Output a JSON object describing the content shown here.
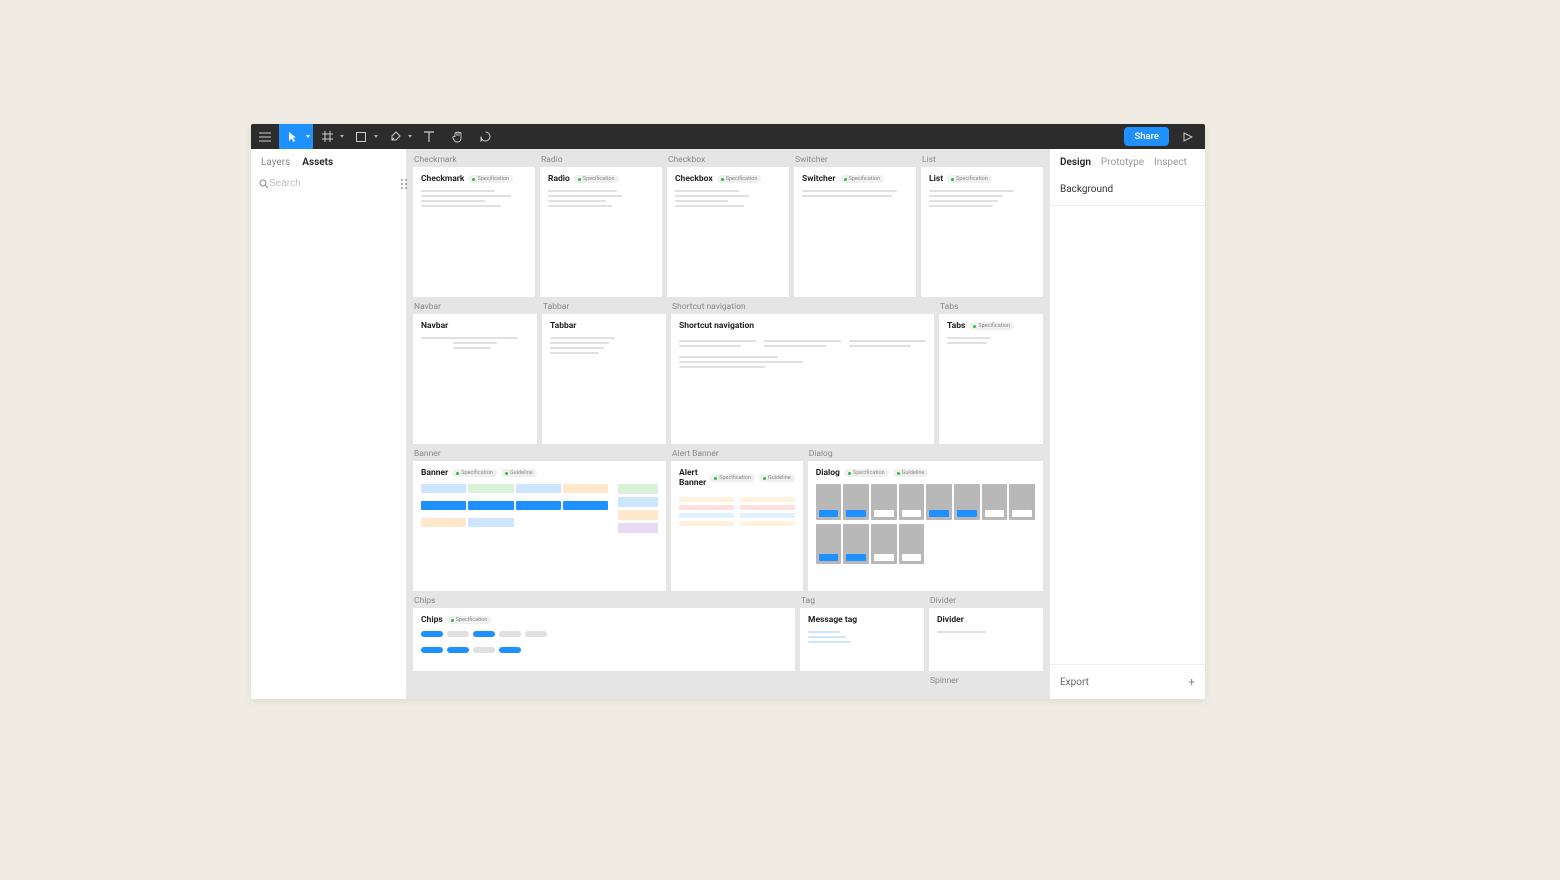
{
  "toolbar": {
    "share_label": "Share"
  },
  "left_panel": {
    "tabs": {
      "layers": "Layers",
      "assets": "Assets"
    },
    "search_placeholder": "Search"
  },
  "right_panel": {
    "tabs": {
      "design": "Design",
      "prototype": "Prototype",
      "inspect": "Inspect"
    },
    "background_label": "Background",
    "export_label": "Export"
  },
  "pills": {
    "specification": "Specification",
    "guideline": "Guideline"
  },
  "frames": {
    "row1": [
      {
        "label": "Checkmark",
        "title": "Checkmark",
        "pills": [
          "specification"
        ]
      },
      {
        "label": "Radio",
        "title": "Radio",
        "pills": [
          "specification"
        ]
      },
      {
        "label": "Checkbox",
        "title": "Checkbox",
        "pills": [
          "specification"
        ]
      },
      {
        "label": "Switcher",
        "title": "Switcher",
        "pills": [
          "specification"
        ]
      },
      {
        "label": "List",
        "title": "List",
        "pills": [
          "specification"
        ]
      }
    ],
    "row2": [
      {
        "label": "Navbar",
        "title": "Navbar",
        "pills": []
      },
      {
        "label": "Tabbar",
        "title": "Tabbar",
        "pills": []
      },
      {
        "label": "Shortcut navigation",
        "title": "Shortcut navigation",
        "pills": []
      },
      {
        "label": "Tabs",
        "title": "Tabs",
        "pills": [
          "specification"
        ]
      }
    ],
    "row3": [
      {
        "label": "Banner",
        "title": "Banner",
        "pills": [
          "specification",
          "guideline"
        ]
      },
      {
        "label": "Alert Banner",
        "title": "Alert Banner",
        "pills": [
          "specification",
          "guideline"
        ]
      },
      {
        "label": "Dialog",
        "title": "Dialog",
        "pills": [
          "specification",
          "guideline"
        ]
      }
    ],
    "row4": [
      {
        "label": "Chips",
        "title": "Chips",
        "pills": [
          "specification"
        ]
      },
      {
        "label": "Tag",
        "title": "Message tag",
        "pills": []
      },
      {
        "label": "Divider",
        "title": "Divider",
        "pills": []
      }
    ],
    "row5": [
      {
        "label": "Spinner",
        "title": "",
        "pills": []
      }
    ]
  }
}
